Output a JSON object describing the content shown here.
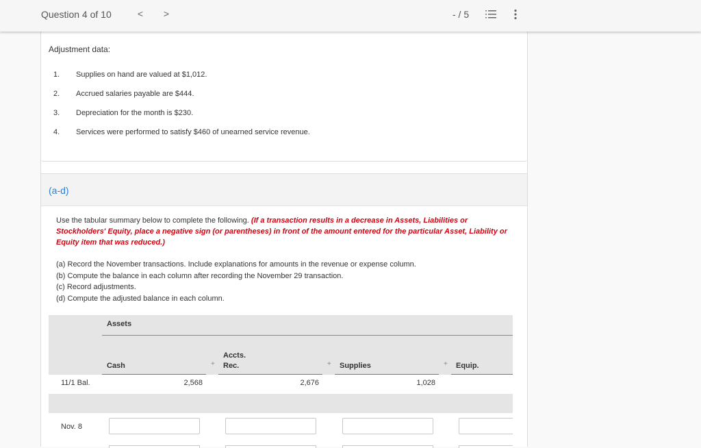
{
  "header": {
    "question_counter": "Question 4 of 10",
    "prev_icon": "chevron-left-icon",
    "next_icon": "chevron-right-icon",
    "prev_glyph": "<",
    "next_glyph": ">",
    "score": "- / 5",
    "list_icon": "numbered-list-icon",
    "more_icon": "more-vertical-icon"
  },
  "adjustment": {
    "title": "Adjustment data:",
    "items": [
      {
        "num": "1.",
        "text": "Supplies on hand are valued at $1,012."
      },
      {
        "num": "2.",
        "text": "Accrued salaries payable are $444."
      },
      {
        "num": "3.",
        "text": "Depreciation for the month is $230."
      },
      {
        "num": "4.",
        "text": "Services were performed to satisfy $460 of unearned service revenue."
      }
    ]
  },
  "part": {
    "label": "(a-d)",
    "label_color": "#2a7fd4",
    "intro": "Use the tabular summary below to complete the following.",
    "warning": "(If a transaction results in a decrease in Assets, Liabilities or Stockholders' Equity, place a negative sign (or parentheses) in front of the amount entered for the particular Asset, Liability or Equity item that was reduced.)",
    "warning_color": "#d6000f",
    "steps": [
      "(a) Record the November transactions. Include explanations for amounts in the revenue or expense column.",
      "(b) Compute the balance in each column after recording the November 29 transaction.",
      "(c) Record adjustments.",
      "(d) Compute the adjusted balance in each column."
    ]
  },
  "table": {
    "group_header": "Assets",
    "columns": [
      {
        "label_line1": "",
        "label_line2": "Cash"
      },
      {
        "label_line1": "Accts.",
        "label_line2": "Rec."
      },
      {
        "label_line1": "",
        "label_line2": "Supplies"
      },
      {
        "label_line1": "",
        "label_line2": "Equip."
      }
    ],
    "operator": "+",
    "rows": [
      {
        "label": "11/1 Bal.",
        "values": [
          "2,568",
          "2,676",
          "1,028",
          ""
        ]
      },
      {
        "label": "Nov. 8",
        "inputs": [
          "",
          "",
          "",
          ""
        ]
      }
    ]
  }
}
